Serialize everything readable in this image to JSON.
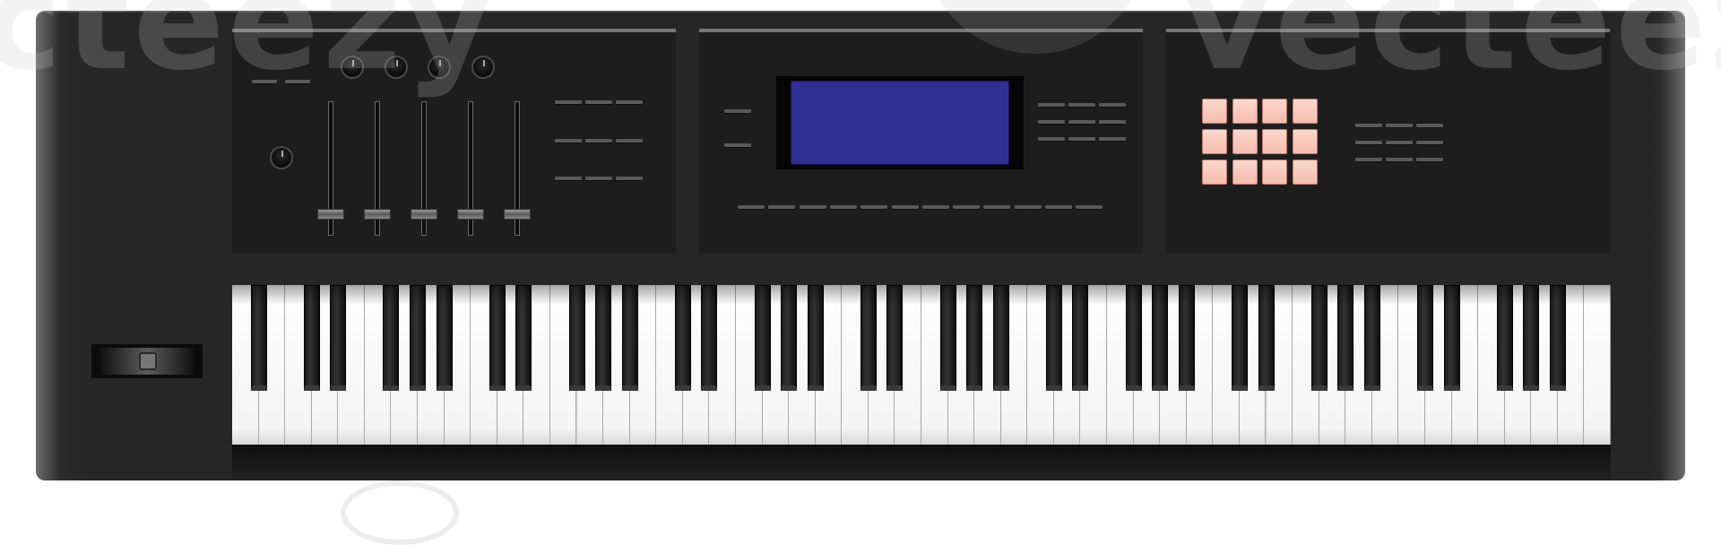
{
  "watermark": {
    "text_left": "cteezy",
    "text_right": "vecteezy"
  },
  "colors": {
    "body": "#262626",
    "panel": "#1d1d1d",
    "lcd": "#2e2e93",
    "pad": "#f6bcad",
    "white_key": "#ffffff",
    "black_key": "#1b1b1b"
  },
  "controls": {
    "top_knob_count": 4,
    "fader_count": 5,
    "pad_grid": {
      "rows": 3,
      "columns": 4
    }
  },
  "keyboard": {
    "white_key_count": 52,
    "black_key_count": 36
  }
}
